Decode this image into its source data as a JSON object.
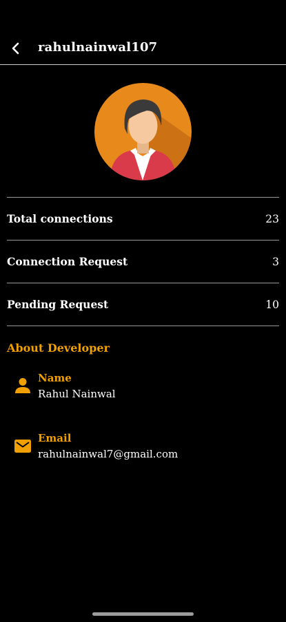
{
  "header": {
    "title": "rahulnainwal107",
    "back_icon": "chevron-left-icon"
  },
  "avatar": {
    "icon": "user-avatar",
    "colors": {
      "circle": "#e8891c",
      "hair": "#3a3a3a",
      "face": "#f6c9a0",
      "jacket": "#d93b4a",
      "shirt": "#ffffff"
    }
  },
  "stats": [
    {
      "label": "Total connections",
      "value": "23"
    },
    {
      "label": "Connection Request",
      "value": "3"
    },
    {
      "label": "Pending Request",
      "value": "10"
    }
  ],
  "about": {
    "title": "About Developer",
    "name_label": "Name",
    "name_value": "Rahul Nainwal",
    "name_icon": "person-icon",
    "email_label": "Email",
    "email_value": "rahulnainwal7@gmail.com",
    "email_icon": "mail-icon"
  },
  "colors": {
    "accent": "#f0a000",
    "background": "#000000",
    "text": "#ffffff"
  }
}
